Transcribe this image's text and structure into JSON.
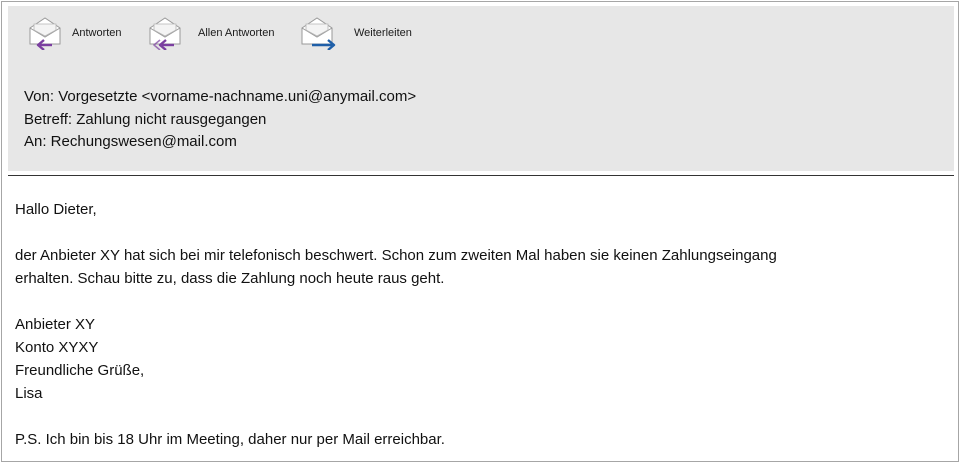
{
  "toolbar": {
    "reply_label": "Antworten",
    "reply_all_label": "Allen Antworten",
    "forward_label": "Weiterleiten",
    "reply_icon": "reply-envelope-icon",
    "reply_all_icon": "reply-all-envelope-icon",
    "forward_icon": "forward-envelope-icon"
  },
  "header": {
    "from": "Von: Vorgesetzte <vorname-nachname.uni@anymail.com>",
    "subject": "Betreff: Zahlung nicht rausgegangen",
    "to": "An: Rechungswesen@mail.com"
  },
  "body": {
    "greeting": "Hallo Dieter,",
    "paragraph_line1": "der Anbieter XY hat sich bei mir telefonisch beschwert. Schon zum zweiten Mal haben sie keinen Zahlungseingang",
    "paragraph_line2": "erhalten. Schau bitte zu, dass die Zahlung noch heute raus geht.",
    "vendor": "Anbieter XY",
    "account": "Konto XYXY",
    "closing": "Freundliche Grüße,",
    "signature": "Lisa",
    "postscript": "P.S. Ich bin bis 18 Uhr im Meeting, daher nur per Mail erreichbar."
  },
  "colors": {
    "header_bg": "#e7e7e7",
    "reply_arrow": "#7b3fa0",
    "forward_arrow": "#1f5fa8"
  }
}
